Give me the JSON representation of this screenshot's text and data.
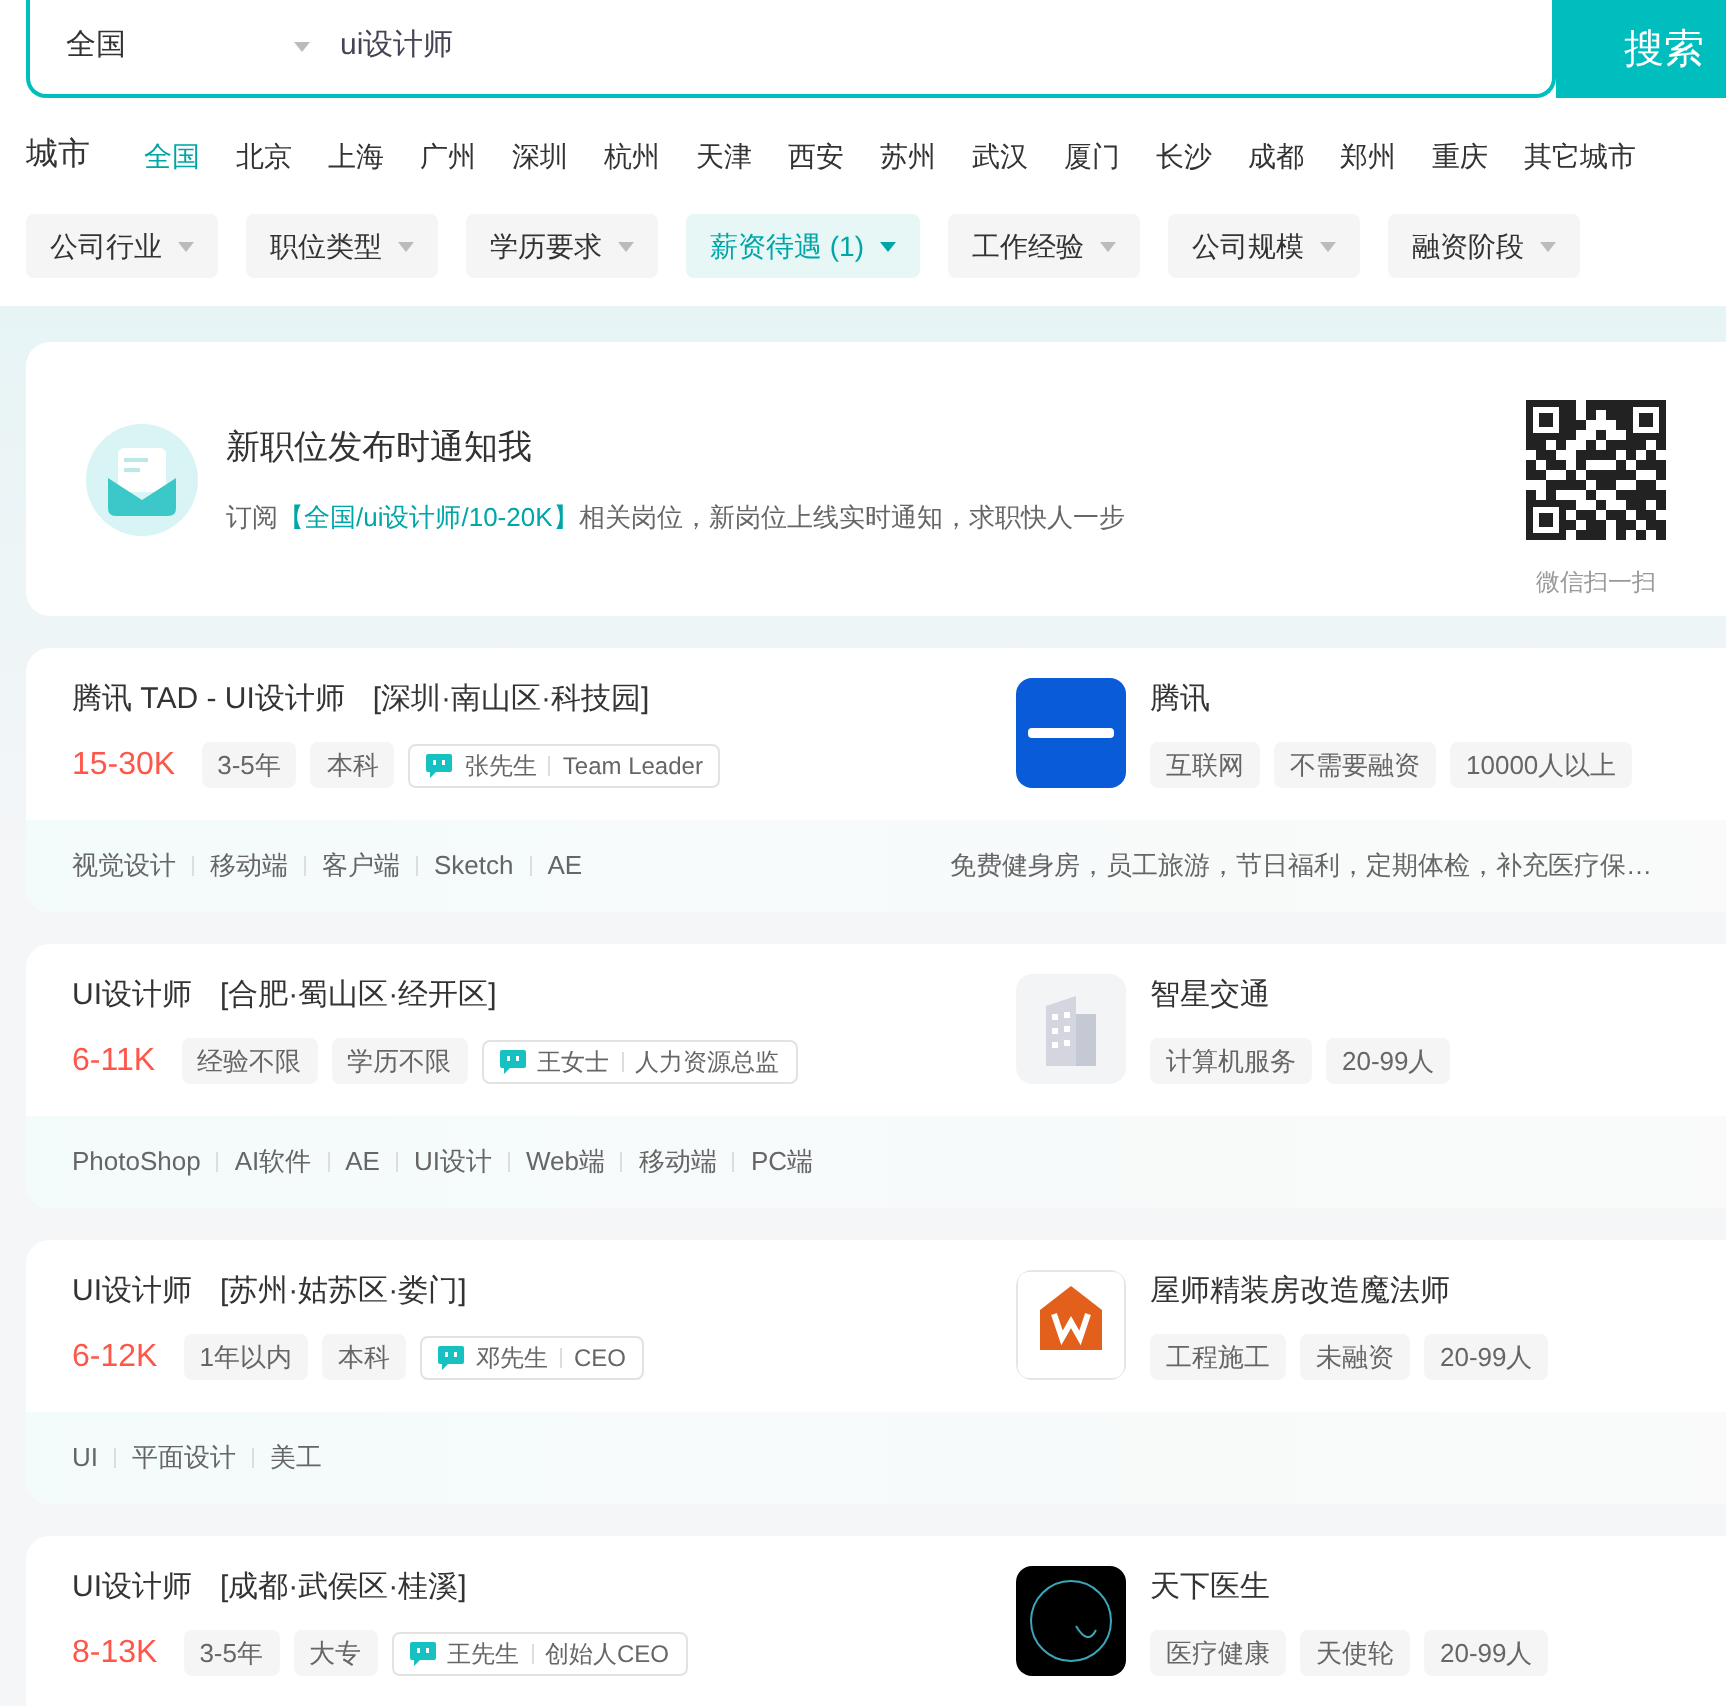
{
  "search": {
    "city": "全国",
    "query": "ui设计师",
    "button": "搜索"
  },
  "city_label": "城市",
  "cities": [
    {
      "label": "全国",
      "selected": true
    },
    {
      "label": "北京",
      "selected": false
    },
    {
      "label": "上海",
      "selected": false
    },
    {
      "label": "广州",
      "selected": false
    },
    {
      "label": "深圳",
      "selected": false
    },
    {
      "label": "杭州",
      "selected": false
    },
    {
      "label": "天津",
      "selected": false
    },
    {
      "label": "西安",
      "selected": false
    },
    {
      "label": "苏州",
      "selected": false
    },
    {
      "label": "武汉",
      "selected": false
    },
    {
      "label": "厦门",
      "selected": false
    },
    {
      "label": "长沙",
      "selected": false
    },
    {
      "label": "成都",
      "selected": false
    },
    {
      "label": "郑州",
      "selected": false
    },
    {
      "label": "重庆",
      "selected": false
    },
    {
      "label": "其它城市",
      "selected": false
    }
  ],
  "filters": [
    {
      "label": "公司行业",
      "selected": false
    },
    {
      "label": "职位类型",
      "selected": false
    },
    {
      "label": "学历要求",
      "selected": false
    },
    {
      "label": "薪资待遇 (1)",
      "selected": true
    },
    {
      "label": "工作经验",
      "selected": false
    },
    {
      "label": "公司规模",
      "selected": false
    },
    {
      "label": "融资阶段",
      "selected": false
    }
  ],
  "subscribe": {
    "title": "新职位发布时通知我",
    "text_before": "订阅",
    "highlight": "【全国/ui设计师/10-20K】",
    "text_after": "相关岗位，新岗位上线实时通知，求职快人一步",
    "qr_caption": "微信扫一扫"
  },
  "jobs": [
    {
      "title": "腾讯 TAD - UI设计师",
      "location": "[深圳·南山区·科技园]",
      "salary": "15-30K",
      "tags": [
        "3-5年",
        "本科"
      ],
      "recruiter": {
        "name": "张先生",
        "role": "Team Leader"
      },
      "company": "腾讯",
      "kind": "wordmark",
      "company_tags": [
        "互联网",
        "不需要融资",
        "10000人以上"
      ],
      "skills": [
        "视觉设计",
        "移动端",
        "客户端",
        "Sketch",
        "AE"
      ],
      "benefits": "免费健身房，员工旅游，节日福利，定期体检，补充医疗保…"
    },
    {
      "title": "UI设计师",
      "location": "[合肥·蜀山区·经开区]",
      "salary": "6-11K",
      "tags": [
        "经验不限",
        "学历不限"
      ],
      "recruiter": {
        "name": "王女士",
        "role": "人力资源总监"
      },
      "company": "智星交通",
      "kind": "building",
      "company_tags": [
        "计算机服务",
        "20-99人"
      ],
      "skills": [
        "PhotoShop",
        "AI软件",
        "AE",
        "UI设计",
        "Web端",
        "移动端",
        "PC端"
      ]
    },
    {
      "title": "UI设计师",
      "location": "[苏州·姑苏区·娄门]",
      "salary": "6-12K",
      "tags": [
        "1年以内",
        "本科"
      ],
      "recruiter": {
        "name": "邓先生",
        "role": "CEO"
      },
      "company": "屋师精装房改造魔法师",
      "kind": "house",
      "company_tags": [
        "工程施工",
        "未融资",
        "20-99人"
      ],
      "skills": [
        "UI",
        "平面设计",
        "美工"
      ]
    },
    {
      "title": "UI设计师",
      "location": "[成都·武侯区·桂溪]",
      "salary": "8-13K",
      "tags": [
        "3-5年",
        "大专"
      ],
      "recruiter": {
        "name": "王先生",
        "role": "创始人CEO"
      },
      "company": "天下医生",
      "kind": "circle",
      "company_tags": [
        "医疗健康",
        "天使轮",
        "20-99人"
      ]
    }
  ]
}
